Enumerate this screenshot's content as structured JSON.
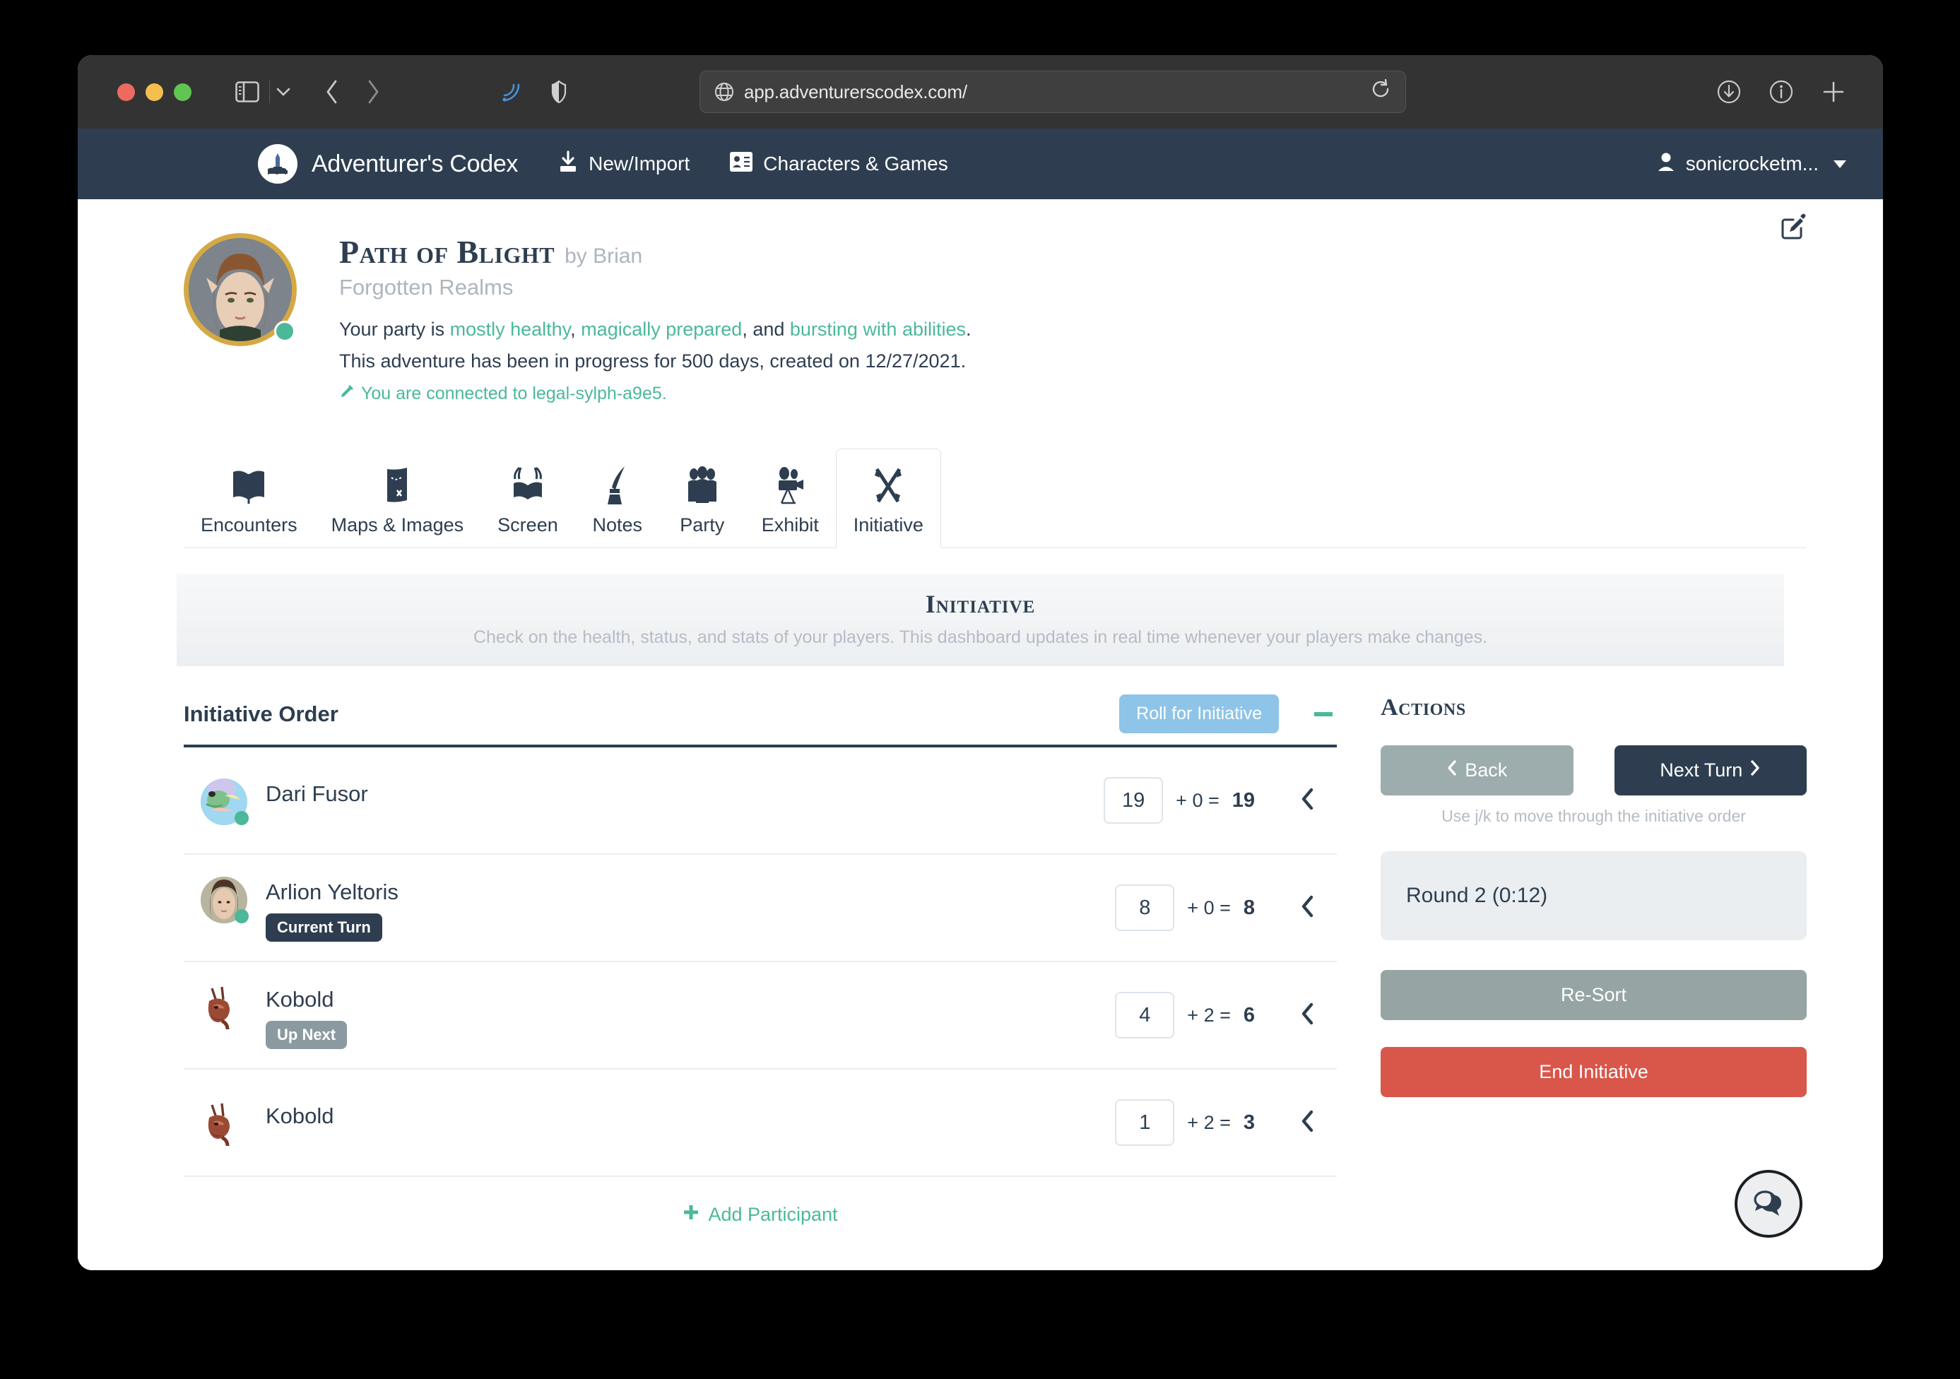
{
  "browser": {
    "url": "app.adventurerscodex.com/",
    "icons": {
      "sidebar": "sidebar-icon",
      "tabgroup": "chevron-down-icon",
      "back": "back-chevron-icon",
      "forward": "forward-chevron-icon",
      "rss": "rss-icon",
      "shield": "privacy-shield-icon",
      "globe": "globe-icon",
      "reload": "reload-icon",
      "download": "download-icon",
      "info": "info-icon",
      "newtab": "plus-icon"
    }
  },
  "navbar": {
    "brand": "Adventurer's Codex",
    "links": [
      {
        "label": "New/Import",
        "icon": "import-icon"
      },
      {
        "label": "Characters & Games",
        "icon": "id-card-icon"
      }
    ],
    "user": "sonicrocketm..."
  },
  "campaign": {
    "title": "Path of Blight",
    "by": "by Brian",
    "setting": "Forgotten Realms",
    "party_intro": "Your party is ",
    "party_status_1": "mostly healthy",
    "sep_1": ", ",
    "party_status_2": "magically prepared",
    "sep_2": ", and ",
    "party_status_3": "bursting with abilities",
    "sep_3": ".",
    "progress": "This adventure has been in progress for 500 days, created on 12/27/2021.",
    "connection": "You are connected to legal-sylph-a9e5.",
    "edit_icon": "edit-square-icon"
  },
  "tabs": [
    {
      "label": "Encounters",
      "icon": "open-book-icon",
      "active": false
    },
    {
      "label": "Maps & Images",
      "icon": "treasure-map-icon",
      "active": false
    },
    {
      "label": "Screen",
      "icon": "dm-screen-icon",
      "active": false
    },
    {
      "label": "Notes",
      "icon": "quill-ink-icon",
      "active": false
    },
    {
      "label": "Party",
      "icon": "people-group-icon",
      "active": false
    },
    {
      "label": "Exhibit",
      "icon": "film-camera-icon",
      "active": false
    },
    {
      "label": "Initiative",
      "icon": "crossed-swords-icon",
      "active": true
    }
  ],
  "banner": {
    "title": "Initiative",
    "subtitle": "Check on the health, status, and stats of your players. This dashboard updates in real time whenever your players make changes."
  },
  "initiative_order": {
    "heading": "Initiative Order",
    "roll_button": "Roll for Initiative",
    "collapse_icon": "minus-icon",
    "add_participant": "Add Participant",
    "participants": [
      {
        "name": "Dari Fusor",
        "roll": "19",
        "modifier": "+ 0 =",
        "total": "19",
        "badge": "",
        "badge_type": "",
        "avatar_type": "token-round",
        "online": true
      },
      {
        "name": "Arlion Yeltoris",
        "roll": "8",
        "modifier": "+ 0 =",
        "total": "8",
        "badge": "Current Turn",
        "badge_type": "current",
        "avatar_type": "portrait-round",
        "online": true
      },
      {
        "name": "Kobold",
        "roll": "4",
        "modifier": "+ 2 =",
        "total": "6",
        "badge": "Up Next",
        "badge_type": "upnext",
        "avatar_type": "monster",
        "online": false
      },
      {
        "name": "Kobold",
        "roll": "1",
        "modifier": "+ 2 =",
        "total": "3",
        "badge": "",
        "badge_type": "",
        "avatar_type": "monster",
        "online": false
      }
    ]
  },
  "actions": {
    "title": "Actions",
    "back": "Back",
    "next_turn": "Next Turn",
    "hint": "Use j/k to move through the initiative order",
    "round": "Round 2 (0:12)",
    "resort": "Re-Sort",
    "end": "End Initiative"
  },
  "fab": {
    "icon": "chat-bubbles-icon"
  },
  "colors": {
    "navy": "#2e3e50",
    "green": "#4bb89a",
    "light_blue": "#8ec4e8",
    "gray": "#96a4a4",
    "red": "#d9564a",
    "gold": "#d4a945"
  }
}
